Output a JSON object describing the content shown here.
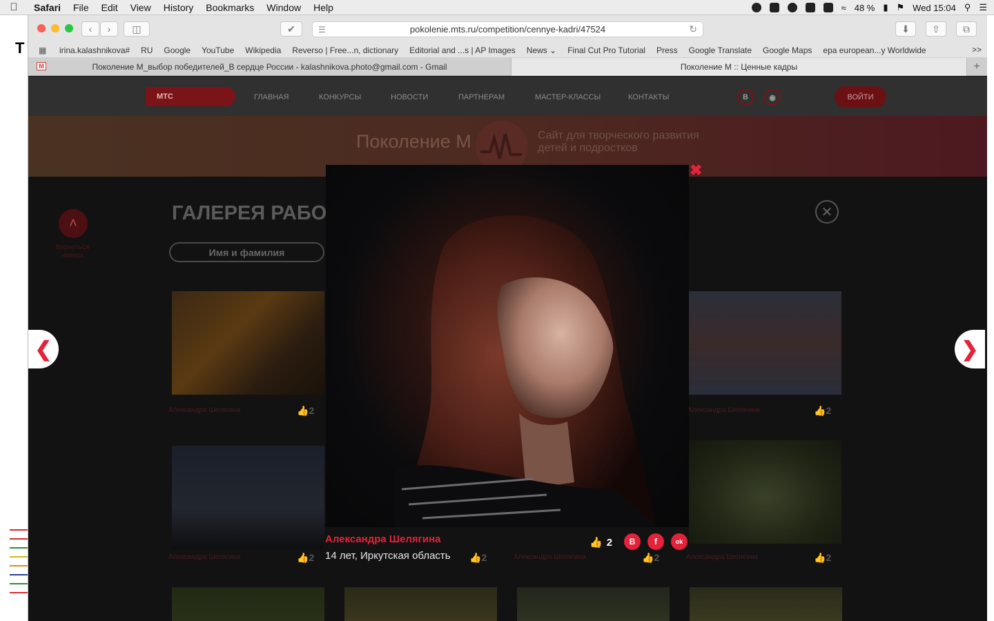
{
  "menubar": {
    "app": "Safari",
    "items": [
      "File",
      "Edit",
      "View",
      "History",
      "Bookmarks",
      "Window",
      "Help"
    ],
    "battery": "48 %",
    "clock": "Wed 15:04"
  },
  "browser": {
    "url": "pokolenie.mts.ru/competition/cennye-kadri/47524",
    "bookmarks": [
      "irina.kalashnikova#",
      "RU",
      "Google",
      "YouTube",
      "Wikipedia",
      "Reverso | Free...n, dictionary",
      "Editorial and ...s | AP Images",
      "News",
      "Final Cut Pro Tutorial",
      "Press",
      "Google Translate",
      "Google Maps",
      "epa european...y Worldwide"
    ],
    "more_label": ">>",
    "tabs": [
      {
        "label": "Поколение М_выбор победителей_В сердце России - kalashnikova.photo@gmail.com - Gmail",
        "icon": "gmail-icon"
      },
      {
        "label": "Поколение М :: Ценные кадры"
      }
    ]
  },
  "site": {
    "logo": "МТС",
    "nav": [
      "ГЛАВНАЯ",
      "КОНКУРСЫ",
      "НОВОСТИ",
      "ПАРТНЕРАМ",
      "МАСТЕР-КЛАССЫ",
      "КОНТАКТЫ"
    ],
    "social_vk": "В",
    "login": "ВОЙТИ",
    "banner_title": "Поколение М",
    "banner_tagline_1": "Сайт для творческого развития",
    "banner_tagline_2": "детей и подростков",
    "back_label": "Вернуться наверх",
    "gallery_title": "ГАЛЕРЕЯ РАБОТ К",
    "search_placeholder": "Имя и фамилия",
    "thumb_author": "Александра Шелягина",
    "thumb_likes": "2"
  },
  "modal": {
    "author": "Александра Шелягина",
    "info": "14 лет, Иркутская область",
    "likes": "2",
    "share": [
      "В",
      "f",
      "ok"
    ]
  },
  "colors": {
    "accent": "#e4223a",
    "brand_dark": "#7a1418"
  }
}
